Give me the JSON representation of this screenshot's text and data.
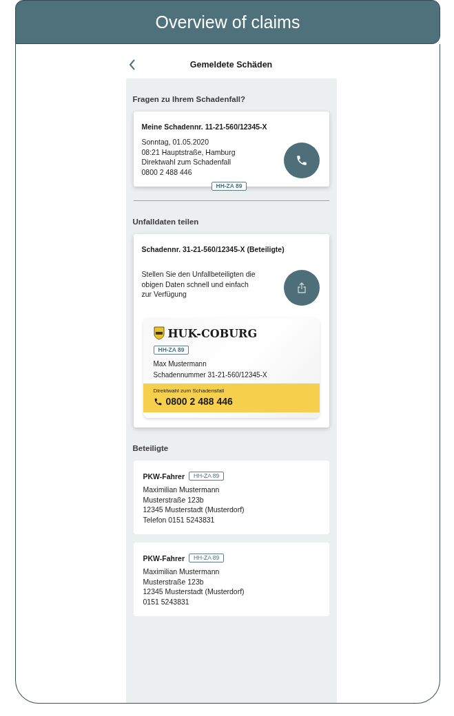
{
  "title": "Overview of claims",
  "app_bar": {
    "title": "Gemeldete Schäden"
  },
  "questions": {
    "heading": "Fragen zu Ihrem Schadenfall?",
    "card": {
      "title": "Meine Schadennr. 11-21-560/12345-X",
      "lines": [
        "Sonntag, 01.05.2020",
        "08:21 Hauptstraße, Hamburg",
        "Direktwahl zum Schadenfall",
        "0800 2 488 446"
      ],
      "plate": "HH-ZA 89"
    }
  },
  "share": {
    "heading": "Unfalldaten teilen",
    "title": "Schadennr. 31-21-560/12345-X (Beteiligte)",
    "text": "Stellen Sie den Unfallbeteiligten die obigen Daten schnell und einfach zur Verfügung",
    "insurance_card": {
      "brand": "HUK-COBURG",
      "plate": "HH-ZA 89",
      "name": "Max Mustermann",
      "claim": "Schadennummer 31-21-560/12345-X",
      "hotline_label": "Direktwahl zum Schadensfall",
      "hotline": "0800 2 488 446"
    }
  },
  "parties": {
    "heading": "Beteiligte",
    "items": [
      {
        "role": "PKW-Fahrer",
        "plate": "HH-ZA 89",
        "lines": [
          "Maximilian Mustermann",
          "Musterstraße 123b",
          "12345 Musterstadt (Musterdorf)",
          "Telefon 0151 5243831"
        ]
      },
      {
        "role": "PKW-Fahrer",
        "plate": "HH-ZA 89",
        "lines": [
          "Maximilian Mustermann",
          "Musterstraße 123b",
          "12345 Musterstadt (Musterdorf)",
          "0151 5243831"
        ]
      }
    ]
  }
}
